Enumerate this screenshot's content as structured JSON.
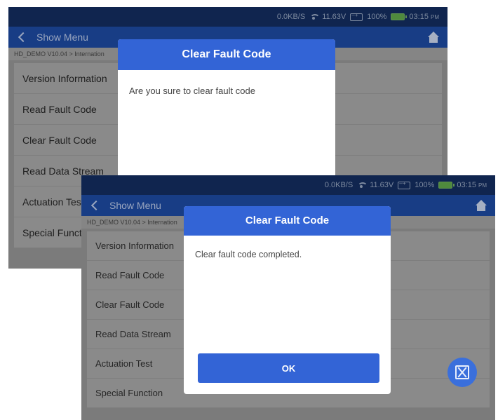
{
  "status": {
    "net_speed": "0.0KB/S",
    "voltage": "11.63V",
    "battery": "100%",
    "time": "03:15",
    "ampm": "PM"
  },
  "nav": {
    "title": "Show Menu"
  },
  "breadcrumb": "HD_DEMO V10.04 > Internation",
  "menu": {
    "items": [
      {
        "label": "Version Information"
      },
      {
        "label": "Read Fault Code"
      },
      {
        "label": "Clear Fault Code"
      },
      {
        "label": "Read Data Stream"
      },
      {
        "label": "Actuation Test"
      },
      {
        "label": "Special Function"
      }
    ]
  },
  "confirm_dialog": {
    "title": "Clear Fault Code",
    "message": "Are you sure to clear fault code"
  },
  "result_dialog": {
    "title": "Clear Fault Code",
    "message": "Clear fault code completed.",
    "ok_label": "OK"
  },
  "icons": {
    "back": "chevron-left-icon",
    "home": "home-icon",
    "wifi": "wifi-icon",
    "voltage": "battery-voltage-icon",
    "battery": "battery-icon",
    "screenshot": "screenshot-icon"
  },
  "colors": {
    "status_bar": "#10254f",
    "nav_bar": "#183d85",
    "dialog_header": "#3364d6",
    "button": "#3364d6"
  }
}
